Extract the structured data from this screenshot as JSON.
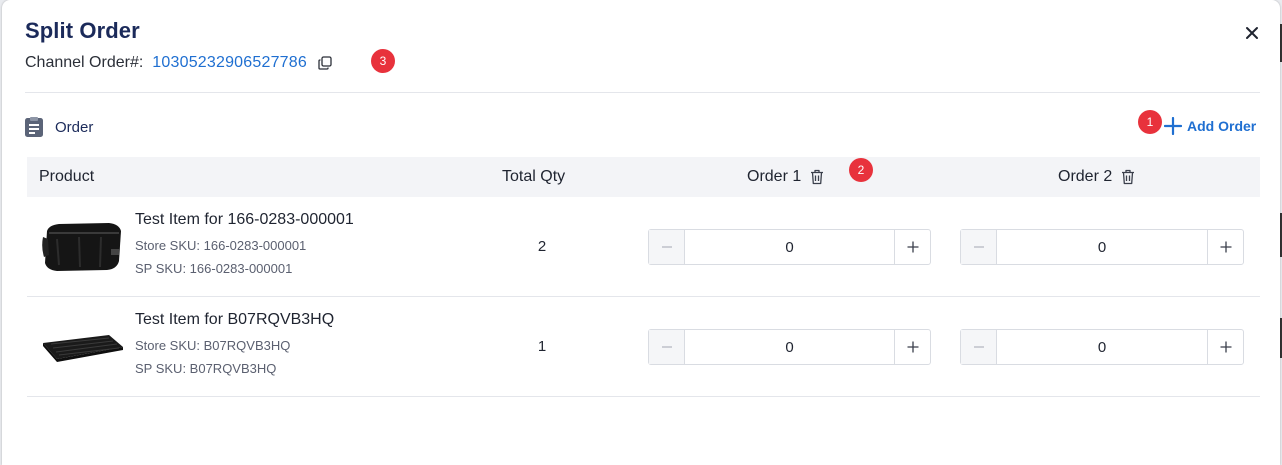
{
  "dialog": {
    "title": "Split Order",
    "channel_label": "Channel Order#:",
    "channel_value": "10305232906527786"
  },
  "section": {
    "title": "Order",
    "add_order_label": "Add Order"
  },
  "badges": [
    "1",
    "2",
    "3"
  ],
  "table": {
    "headers": {
      "product": "Product",
      "total_qty": "Total Qty",
      "order1": "Order 1",
      "order2": "Order 2"
    },
    "rows": [
      {
        "name": "Test Item for 166-0283-000001",
        "store_sku": "Store SKU: 166-0283-000001",
        "sp_sku": "SP SKU: 166-0283-000001",
        "total_qty": "2",
        "order1_qty": "0",
        "order2_qty": "0",
        "thumb_icon": "car-trunk-organizer-image"
      },
      {
        "name": "Test Item for B07RQVB3HQ",
        "store_sku": "Store SKU: B07RQVB3HQ",
        "sp_sku": "SP SKU: B07RQVB3HQ",
        "total_qty": "1",
        "order1_qty": "0",
        "order2_qty": "0",
        "thumb_icon": "keyboard-image"
      }
    ]
  },
  "colors": {
    "title": "#1b2a5a",
    "link": "#1f6fd1",
    "badge": "#e8323c",
    "header_bg": "#f3f4f7"
  }
}
